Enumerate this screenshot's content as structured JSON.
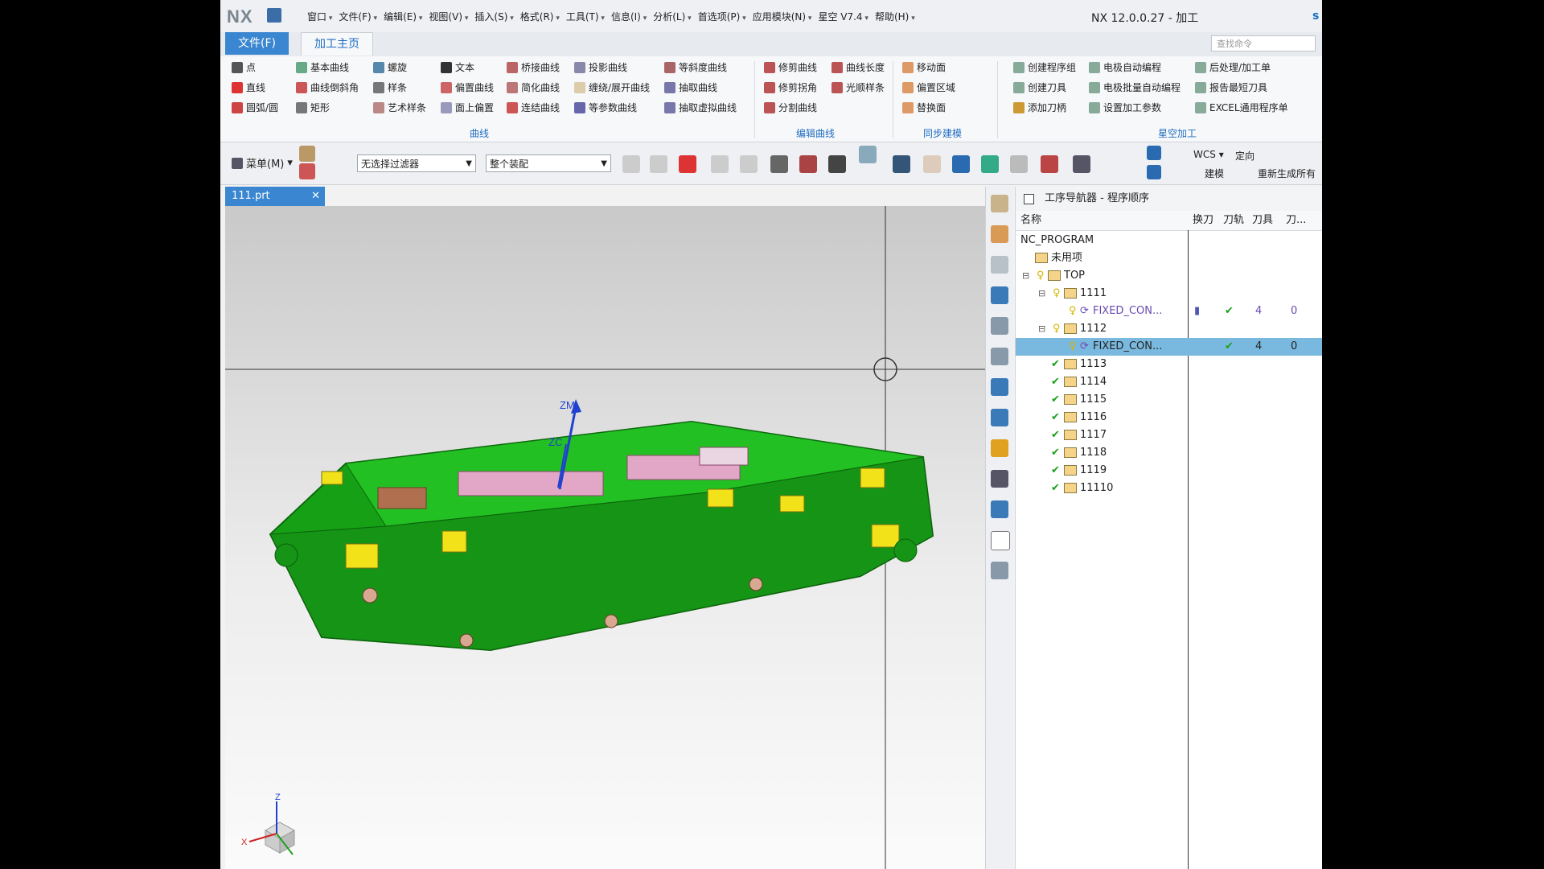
{
  "title_bar": {
    "logo": "NX",
    "app_title": "NX 12.0.0.27 - 加工",
    "right_partial": "s",
    "menus": [
      "窗口",
      "文件(F)",
      "编辑(E)",
      "视图(V)",
      "插入(S)",
      "格式(R)",
      "工具(T)",
      "信息(I)",
      "分析(L)",
      "首选项(P)",
      "应用模块(N)",
      "星空 V7.4",
      "帮助(H)"
    ]
  },
  "tabs": {
    "file": "文件(F)",
    "home": "加工主页"
  },
  "search": {
    "placeholder": "查找命令"
  },
  "ribbon": {
    "curve_col1": [
      "点",
      "直线",
      "圆弧/圆"
    ],
    "curve_col2": [
      "基本曲线",
      "曲线倒斜角",
      "矩形"
    ],
    "curve_col3": [
      "螺旋",
      "样条",
      "艺术样条"
    ],
    "curve_col4": [
      "文本",
      "偏置曲线",
      "面上偏置"
    ],
    "curve_col5": [
      "桥接曲线",
      "简化曲线",
      "连结曲线"
    ],
    "curve_col6": [
      "投影曲线",
      "缠绕/展开曲线",
      "等参数曲线"
    ],
    "curve_col7": [
      "等斜度曲线",
      "抽取曲线",
      "抽取虚拟曲线"
    ],
    "edit_col1": [
      "修剪曲线",
      "修剪拐角",
      "分割曲线"
    ],
    "edit_col2": [
      "曲线长度",
      "光顺样条"
    ],
    "sync_col": [
      "移动面",
      "偏置区域",
      "替换面"
    ],
    "xk_col1": [
      "创建程序组",
      "创建刀具",
      "添加刀柄"
    ],
    "xk_col2": [
      "电极自动编程",
      "电极批量自动编程",
      "设置加工参数"
    ],
    "xk_col3": [
      "后处理/加工单",
      "报告最短刀具",
      "EXCEL通用程序单"
    ],
    "groups": {
      "curve": "曲线",
      "edit": "编辑曲线",
      "sync": "同步建模",
      "xk": "星空加工"
    }
  },
  "toolbar": {
    "menu_label": "菜单(M)",
    "filter_value": "无选择过滤器",
    "assembly_value": "整个装配",
    "wcs": "WCS",
    "orient": "定向",
    "build": "建模",
    "regen": "重新生成所有"
  },
  "doc_tab": {
    "name": "111.prt"
  },
  "viewport": {
    "zm": "ZM",
    "zc": "ZC",
    "tri_z": "Z",
    "tri_x": "X"
  },
  "navigator": {
    "title": "工序导航器 - 程序顺序",
    "columns": [
      "名称",
      "换刀",
      "刀轨",
      "刀具",
      "刀..."
    ],
    "rows": [
      {
        "name": "NC_PROGRAM"
      },
      {
        "name": "未用项"
      },
      {
        "name": "TOP"
      },
      {
        "name": "1111"
      },
      {
        "name": "FIXED_CON...",
        "tool": "4",
        "extra": "0"
      },
      {
        "name": "1112"
      },
      {
        "name": "FIXED_CON...",
        "tool": "4",
        "extra": "0"
      },
      {
        "name": "1113"
      },
      {
        "name": "1114"
      },
      {
        "name": "1115"
      },
      {
        "name": "1116"
      },
      {
        "name": "1117"
      },
      {
        "name": "1118"
      },
      {
        "name": "1119"
      },
      {
        "name": "11110"
      }
    ]
  },
  "colors": {
    "accent": "#3a86d0",
    "model_green": "#22b022",
    "model_yellow": "#f2e21a",
    "selected_row": "#7ab9df"
  }
}
